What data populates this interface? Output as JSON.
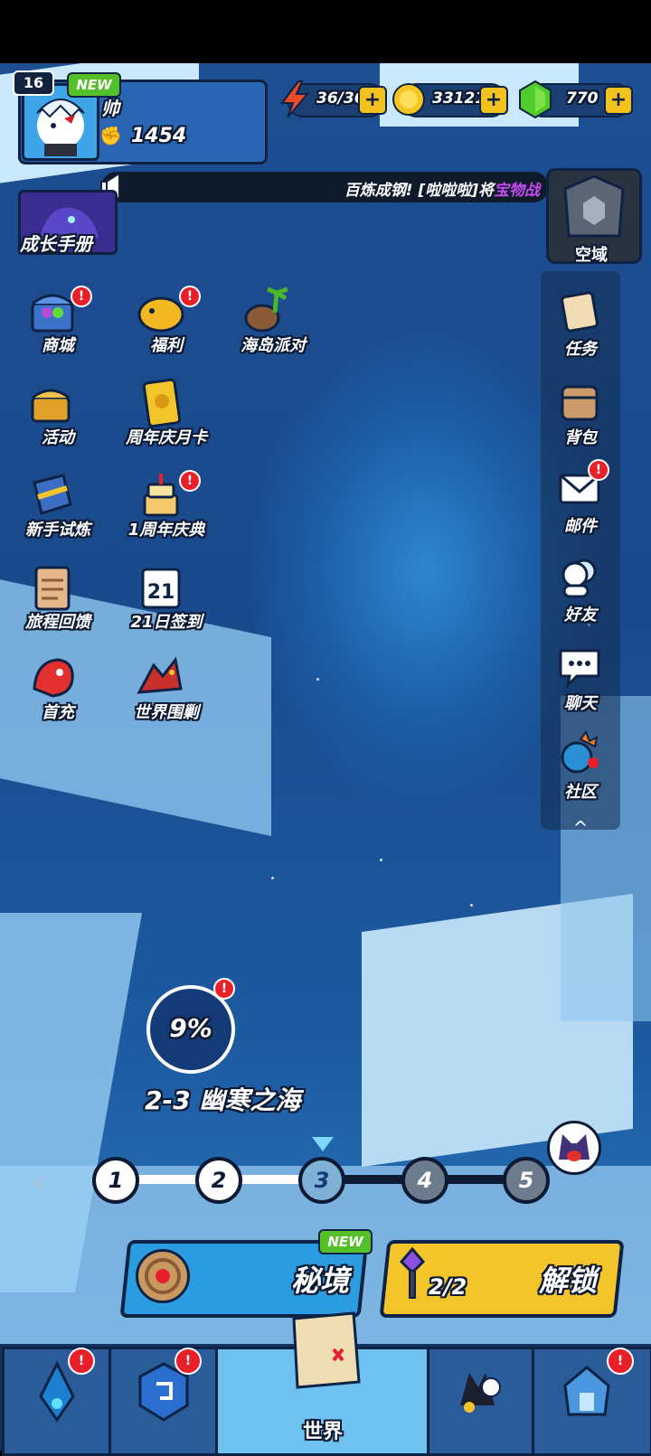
{
  "player": {
    "level": "16",
    "new_tag": "NEW",
    "name": "帅",
    "power": "1454"
  },
  "resources": {
    "stamina": "36/36",
    "coins": "33121",
    "gems": "770",
    "plus": "+"
  },
  "ticker": {
    "prefix": "百炼成钢! [啦啦啦]将",
    "highlight": "宝物战"
  },
  "handbook": {
    "label": "成长手册"
  },
  "void": {
    "label": "空域"
  },
  "left_menu": [
    {
      "label": "商城",
      "icon": "treasure-chest-icon",
      "badge": "!"
    },
    {
      "label": "福利",
      "icon": "piggy-bank-icon",
      "badge": "!"
    },
    {
      "label": "海岛派对",
      "icon": "coconut-island-icon",
      "badge": ""
    },
    {
      "label": "活动",
      "icon": "gift-chest-icon",
      "badge": ""
    },
    {
      "label": "周年庆月卡",
      "icon": "gold-card-icon",
      "badge": ""
    },
    {
      "label": "新手试炼",
      "icon": "shield-sword-icon",
      "badge": ""
    },
    {
      "label": "1周年庆典",
      "icon": "birthday-cake-icon",
      "badge": "!"
    },
    {
      "label": "旅程回馈",
      "icon": "clipboard-icon",
      "badge": ""
    },
    {
      "label": "21日签到",
      "icon": "calendar-icon",
      "calendar_day": "21",
      "badge": ""
    },
    {
      "label": "首充",
      "icon": "red-dragon-icon",
      "badge": ""
    },
    {
      "label": "世界围剿",
      "icon": "fire-dragon-icon",
      "badge": ""
    }
  ],
  "right_menu": [
    {
      "label": "任务",
      "icon": "scroll-icon",
      "badge": ""
    },
    {
      "label": "背包",
      "icon": "backpack-icon",
      "badge": ""
    },
    {
      "label": "邮件",
      "icon": "mail-icon",
      "badge": "!"
    },
    {
      "label": "好友",
      "icon": "friends-icon",
      "badge": ""
    },
    {
      "label": "聊天",
      "icon": "chat-icon",
      "badge": ""
    },
    {
      "label": "社区",
      "icon": "community-icon",
      "badge": ""
    }
  ],
  "collapse": "^",
  "progress": {
    "percent": "9%",
    "stage": "2-3 幽寒之海",
    "badge": "!"
  },
  "levels": [
    "1",
    "2",
    "3",
    "4",
    "5"
  ],
  "current_level": "3",
  "actions": {
    "secret_label": "秘境",
    "secret_new": "NEW",
    "unlock_label": "解锁",
    "keys": "2/2"
  },
  "nav": {
    "world_label": "世界",
    "badge": "!"
  },
  "colors": {
    "accent_yellow": "#f4c52a",
    "accent_blue": "#2c9ce0",
    "badge_red": "#e8202a",
    "new_green": "#55c12a"
  }
}
